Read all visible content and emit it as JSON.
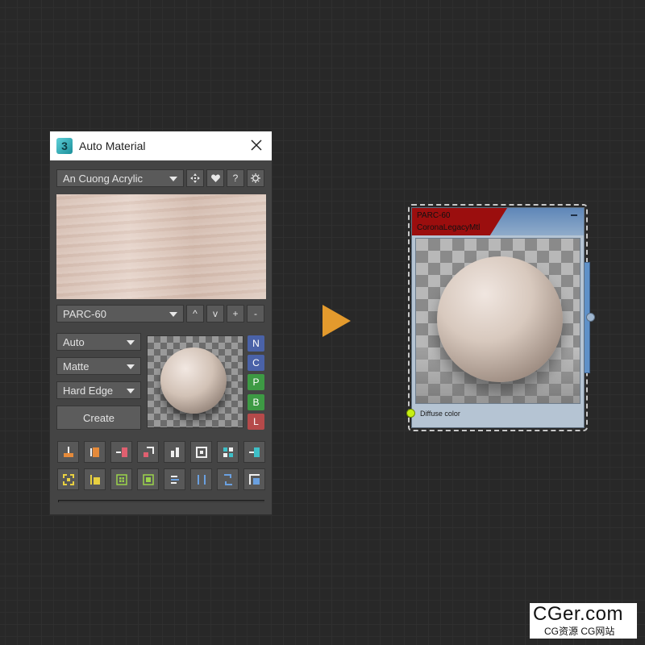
{
  "window": {
    "app_icon": "3",
    "title": "Auto Material",
    "close_icon": "close-icon"
  },
  "library": {
    "selected": "An Cuong Acrylic",
    "buttons": [
      "move-icon",
      "heart-icon",
      "?",
      "sun-icon"
    ]
  },
  "material": {
    "selected": "PARC-60",
    "buttons": [
      "^",
      "v",
      "+",
      "-"
    ]
  },
  "options": {
    "mode": "Auto",
    "finish": "Matte",
    "edge": "Hard Edge",
    "create_label": "Create"
  },
  "maps": [
    {
      "label": "N",
      "color": "#4a62a8"
    },
    {
      "label": "C",
      "color": "#4a62a8"
    },
    {
      "label": "P",
      "color": "#3d9a44"
    },
    {
      "label": "B",
      "color": "#3d9a44"
    },
    {
      "label": "L",
      "color": "#b54a4a"
    }
  ],
  "colors": {
    "accent_arrow": "#e39a2d",
    "node_header": "#9b0e0e",
    "socket": "#c7ef13"
  },
  "node": {
    "name": "PARC-60",
    "type": "CoronaLegacyMtl",
    "input_label": "Diffuse color"
  },
  "watermark": {
    "main": "CGer.com",
    "sub": "CG资源 CG网站"
  }
}
